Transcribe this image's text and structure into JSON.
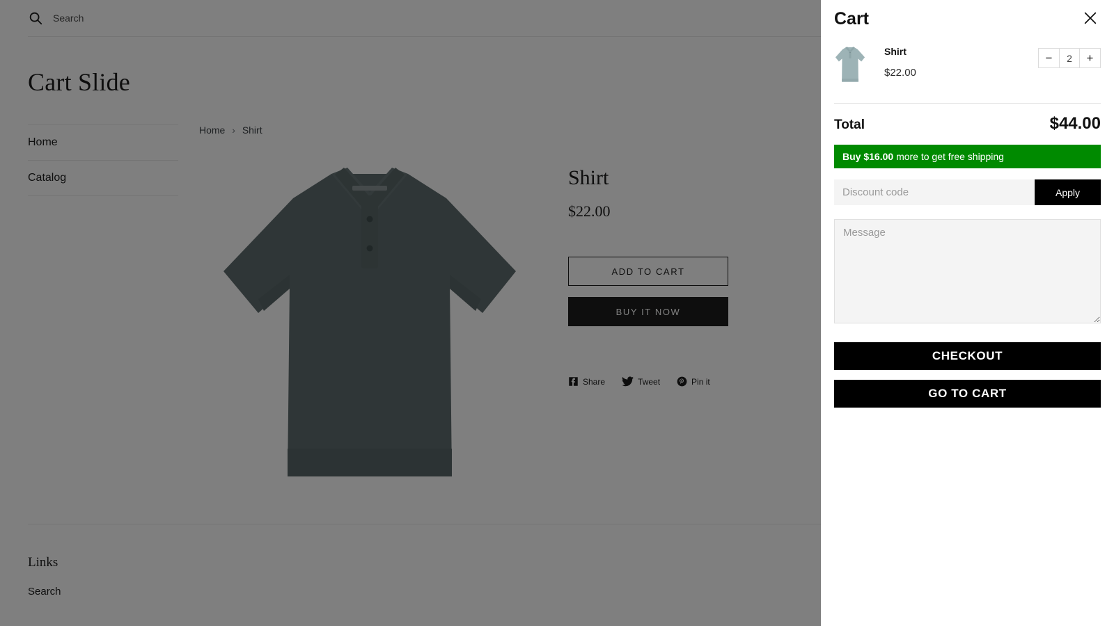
{
  "header": {
    "search_placeholder": "Search",
    "search_value": "",
    "search_icon": "search-icon",
    "cart_icon": "shopping-cart-icon"
  },
  "store": {
    "title": "Cart Slide"
  },
  "sidebar": {
    "items": [
      {
        "label": "Home"
      },
      {
        "label": "Catalog"
      }
    ]
  },
  "breadcrumb": {
    "home": "Home",
    "separator": "›",
    "current": "Shirt"
  },
  "product": {
    "title": "Shirt",
    "price": "$22.00",
    "add_to_cart_label": "ADD TO CART",
    "buy_now_label": "BUY IT NOW",
    "share": [
      {
        "label": "Share",
        "icon": "facebook-icon"
      },
      {
        "label": "Tweet",
        "icon": "twitter-icon"
      },
      {
        "label": "Pin it",
        "icon": "pinterest-icon"
      }
    ]
  },
  "footer": {
    "heading": "Links",
    "links": [
      {
        "label": "Search"
      }
    ]
  },
  "cart": {
    "title": "Cart",
    "close_icon": "close-icon",
    "items": [
      {
        "name": "Shirt",
        "price": "$22.00",
        "quantity": "2",
        "decrease_label": "−",
        "increase_label": "+",
        "thumbnail_icon": "polo-shirt-thumbnail"
      }
    ],
    "total_label": "Total",
    "total_value": "$44.00",
    "shipping_notice": {
      "prefix": "Buy",
      "amount": "$16.00",
      "suffix": "more to get free shipping",
      "background_color": "#008a00",
      "text_color": "#ffffff"
    },
    "discount_placeholder": "Discount code",
    "discount_value": "",
    "apply_label": "Apply",
    "message_placeholder": "Message",
    "message_value": "",
    "checkout_label": "CHECKOUT",
    "go_to_cart_label": "GO TO CART"
  },
  "colors": {
    "accent_black": "#000000",
    "shipping_green": "#008a00",
    "overlay": "rgba(0,0,0,0.5)",
    "shirt_gray": "#5f6d6e"
  }
}
